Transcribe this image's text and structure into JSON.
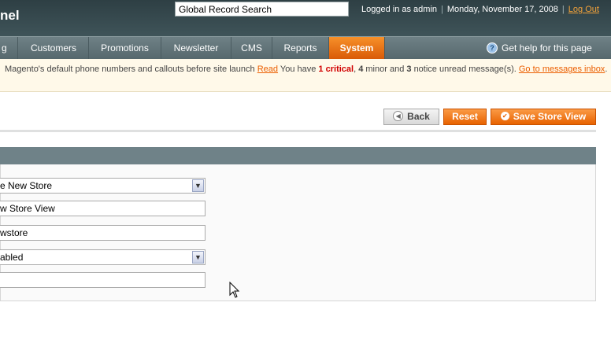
{
  "header": {
    "logo_fragment": "nel",
    "search": {
      "value": "Global Record Search"
    },
    "logged_in_text": "Logged in as admin",
    "date_text": "Monday, November 17, 2008",
    "logout_label": "Log Out"
  },
  "nav": {
    "items": [
      {
        "label": "g"
      },
      {
        "label": "Customers"
      },
      {
        "label": "Promotions"
      },
      {
        "label": "Newsletter"
      },
      {
        "label": "CMS"
      },
      {
        "label": "Reports"
      },
      {
        "label": "System",
        "active": true
      }
    ],
    "help_label": "Get help for this page"
  },
  "notice": {
    "text": "Magento's default phone numbers and callouts before site launch",
    "read_label": "Read",
    "you_have": "You have",
    "critical_count": "1",
    "critical_label": "critical",
    "minor_count": "4",
    "minor_label": "minor and",
    "notice_count": "3",
    "notice_label": "notice unread message(s).",
    "inbox_link": "Go to messages inbox",
    "tail": "."
  },
  "actions": {
    "back_label": "Back",
    "reset_label": "Reset",
    "save_label": "Save Store View"
  },
  "form": {
    "store_select": "e New Store",
    "name_value": "w Store View",
    "code_value": "wstore",
    "status_select": "abled",
    "sort_order_value": ""
  },
  "colors": {
    "accent_orange": "#e76200",
    "header_bg": "#2e3f44",
    "nav_bg": "#56686d"
  }
}
